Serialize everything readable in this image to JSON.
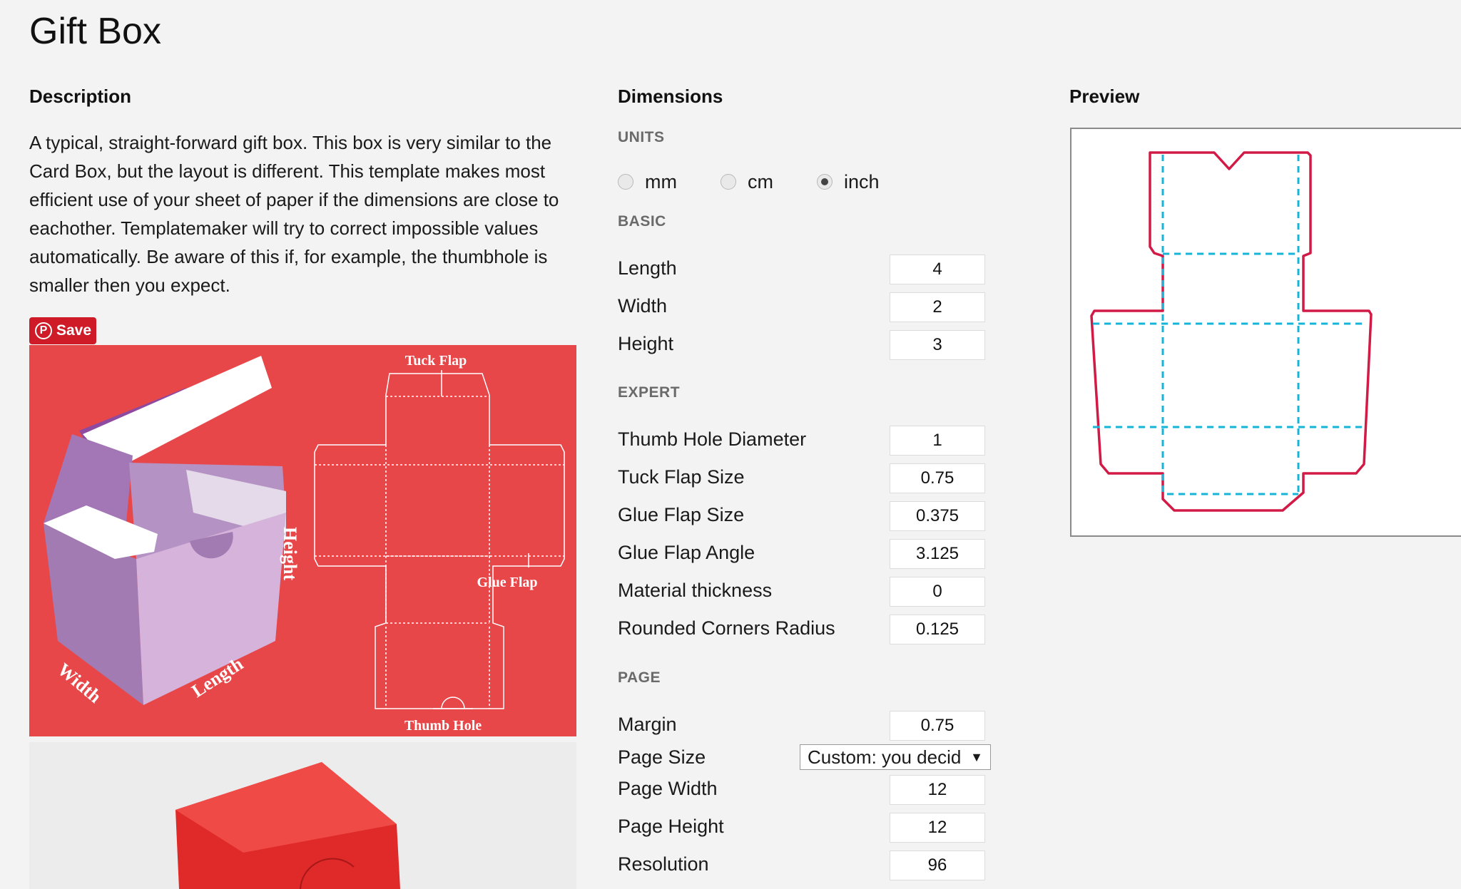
{
  "page": {
    "title": "Gift Box"
  },
  "description": {
    "heading": "Description",
    "text": "A typical, straight-forward gift box. This box is very similar to the Card Box, but the layout is different. This template makes most efficient use of your sheet of paper if the dimensions are close to eachother. Templatemaker will try to correct impossible values automatically. Be aware of this if, for example, the thumbhole is smaller then you expect.",
    "save_label": "Save",
    "save_logo": "P",
    "diagram_labels": {
      "tuck_flap": "Tuck Flap",
      "height": "Height",
      "glue_flap": "Glue Flap",
      "width": "Width",
      "length": "Length",
      "thumb_hole": "Thumb Hole"
    }
  },
  "dimensions": {
    "heading": "Dimensions",
    "units_label": "UNITS",
    "units": [
      {
        "label": "mm",
        "checked": false
      },
      {
        "label": "cm",
        "checked": false
      },
      {
        "label": "inch",
        "checked": true
      }
    ],
    "basic_label": "BASIC",
    "basic": [
      {
        "label": "Length",
        "value": "4"
      },
      {
        "label": "Width",
        "value": "2"
      },
      {
        "label": "Height",
        "value": "3"
      }
    ],
    "expert_label": "EXPERT",
    "expert": [
      {
        "label": "Thumb Hole Diameter",
        "value": "1"
      },
      {
        "label": "Tuck Flap Size",
        "value": "0.75"
      },
      {
        "label": "Glue Flap Size",
        "value": "0.375"
      },
      {
        "label": "Glue Flap Angle",
        "value": "3.125"
      },
      {
        "label": "Material thickness",
        "value": "0"
      },
      {
        "label": "Rounded Corners Radius",
        "value": "0.125"
      }
    ],
    "page_label": "PAGE",
    "margin": {
      "label": "Margin",
      "value": "0.75"
    },
    "page_size": {
      "label": "Page Size",
      "value": "Custom: you decid",
      "arrow": "▼"
    },
    "page_width": {
      "label": "Page Width",
      "value": "12"
    },
    "page_height": {
      "label": "Page Height",
      "value": "12"
    },
    "resolution": {
      "label": "Resolution",
      "value": "96"
    }
  },
  "preview": {
    "heading": "Preview",
    "cut_color": "#d11a45",
    "fold_color": "#1ab3d8"
  },
  "colors": {
    "pinterest": "#cf1a27",
    "diagram_bg": "#e8474a",
    "box_purple": "#d4b3db"
  }
}
